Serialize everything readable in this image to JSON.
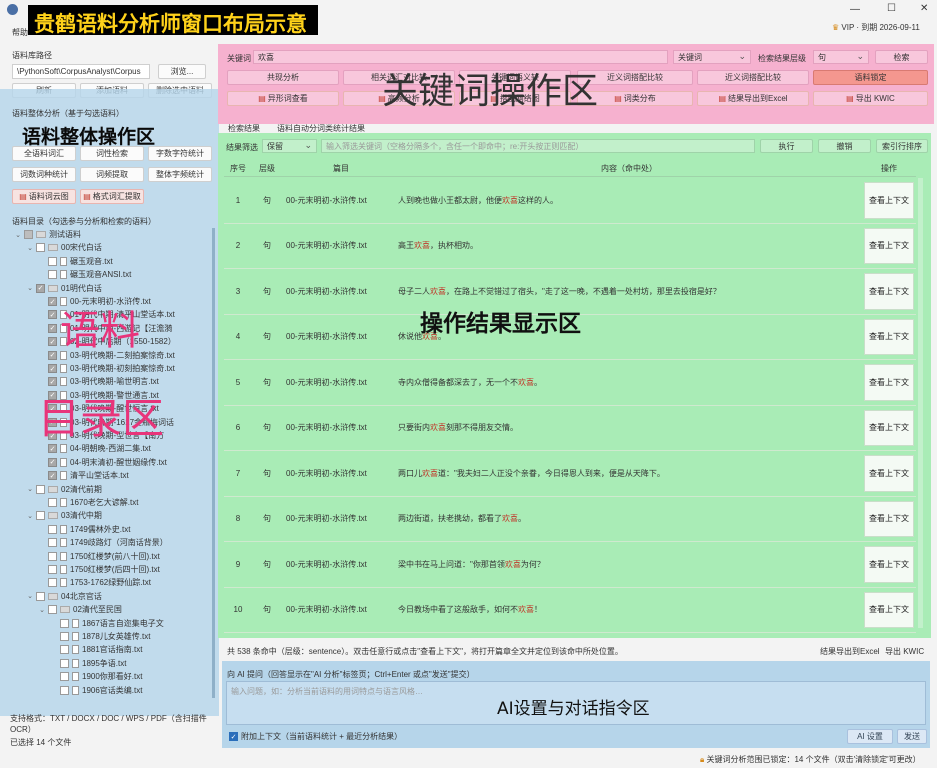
{
  "window": {
    "title": "贵鹤语料分析师窗口布局示意",
    "menu_help": "帮助",
    "vip": "VIP · 到期 2026-09-11",
    "min_icon": "—",
    "max_icon": "☐",
    "close_icon": "✕"
  },
  "overlays": {
    "keyword_area": "关键词操作区",
    "corpus_overall": "语料整体操作区",
    "corpus_dir_1": "语料",
    "corpus_dir_2": "目录区",
    "results_area": "操作结果显示区",
    "ai_area": "AI设置与对话指令区"
  },
  "corpus_path": {
    "label": "语料库路径",
    "value": "\\PythonSoft\\CorpusAnalyst\\Corpus",
    "browse": "浏览...",
    "refresh": "刷新",
    "add_corpus": "添加语料",
    "delete_selected": "删除选中语料"
  },
  "overall_ops": {
    "label": "语料整体分析（基于勾选语料）",
    "buttons": [
      "全语料词汇",
      "词性检索",
      "字数字符统计",
      "词数词种统计",
      "词频提取",
      "整体字频统计"
    ],
    "wordcloud": "语料词云图",
    "style_cmp": "格式词汇提取"
  },
  "corpus_tree": {
    "label": "语料目录（勾选参与分析和检索的语料）",
    "items": [
      {
        "level": 0,
        "type": "folder",
        "check": "part",
        "name": "测试语料"
      },
      {
        "level": 1,
        "type": "folder",
        "check": "off",
        "name": "00宋代白话"
      },
      {
        "level": 2,
        "type": "file",
        "check": "off",
        "name": "碾玉观音.txt"
      },
      {
        "level": 2,
        "type": "file",
        "check": "off",
        "name": "碾玉观音ANSI.txt"
      },
      {
        "level": 1,
        "type": "folder",
        "check": "on",
        "name": "01明代白话"
      },
      {
        "level": 2,
        "type": "file",
        "check": "on",
        "name": "00-元末明初-水浒传.txt"
      },
      {
        "level": 2,
        "type": "file",
        "check": "on",
        "name": "01-明代中期-清平山堂话本.txt"
      },
      {
        "level": 2,
        "type": "file",
        "check": "on",
        "name": "01-明代中期-西游记【汪澹漪"
      },
      {
        "level": 2,
        "type": "file",
        "check": "on",
        "name": "02-明代中后期（1550-1582）"
      },
      {
        "level": 2,
        "type": "file",
        "check": "on",
        "name": "03-明代晚期-二刻拍案惊奇.txt"
      },
      {
        "level": 2,
        "type": "file",
        "check": "on",
        "name": "03-明代晚期-初刻拍案惊奇.txt"
      },
      {
        "level": 2,
        "type": "file",
        "check": "on",
        "name": "03-明代晚期-喻世明言.txt"
      },
      {
        "level": 2,
        "type": "file",
        "check": "on",
        "name": "03-明代晚期-警世通言.txt"
      },
      {
        "level": 2,
        "type": "file",
        "check": "on",
        "name": "03-明代晚期-醒世恒言.txt"
      },
      {
        "level": 2,
        "type": "file",
        "check": "on",
        "name": "03-明代晚期-1617金瓶梅词话"
      },
      {
        "level": 2,
        "type": "file",
        "check": "on",
        "name": "03-明代晚期-型世言【南方"
      },
      {
        "level": 2,
        "type": "file",
        "check": "on",
        "name": "04-明朝晚-西湖二集.txt"
      },
      {
        "level": 2,
        "type": "file",
        "check": "on",
        "name": "04-明末清初-醒世姻缘传.txt"
      },
      {
        "level": 2,
        "type": "file",
        "check": "on",
        "name": "清平山堂话本.txt"
      },
      {
        "level": 1,
        "type": "folder",
        "check": "off",
        "name": "02清代前期"
      },
      {
        "level": 2,
        "type": "file",
        "check": "off",
        "name": "1670老乞大谚解.txt"
      },
      {
        "level": 1,
        "type": "folder",
        "check": "off",
        "name": "03清代中期"
      },
      {
        "level": 2,
        "type": "file",
        "check": "off",
        "name": "1749儒林外史.txt"
      },
      {
        "level": 2,
        "type": "file",
        "check": "off",
        "name": "1749歧路灯（河南话背景）"
      },
      {
        "level": 2,
        "type": "file",
        "check": "off",
        "name": "1750红楼梦(前八十回).txt"
      },
      {
        "level": 2,
        "type": "file",
        "check": "off",
        "name": "1750红楼梦(后四十回).txt"
      },
      {
        "level": 2,
        "type": "file",
        "check": "off",
        "name": "1753-1762绿野仙踪.txt"
      },
      {
        "level": 1,
        "type": "folder",
        "check": "off",
        "name": "04北京官话"
      },
      {
        "level": 2,
        "type": "folder",
        "check": "off",
        "name": "02清代至民国"
      },
      {
        "level": 3,
        "type": "file",
        "check": "off",
        "name": "1867语言自迩集电子文"
      },
      {
        "level": 3,
        "type": "file",
        "check": "off",
        "name": "1878儿女英雄传.txt"
      },
      {
        "level": 3,
        "type": "file",
        "check": "off",
        "name": "1881官话指南.txt"
      },
      {
        "level": 3,
        "type": "file",
        "check": "off",
        "name": "1895争语.txt"
      },
      {
        "level": 3,
        "type": "file",
        "check": "off",
        "name": "1900你那看好.txt"
      },
      {
        "level": 3,
        "type": "file",
        "check": "off",
        "name": "1906官话类编.txt"
      }
    ],
    "support": "支持格式：TXT / DOCX / DOC / WPS / PDF（含扫描件 OCR）",
    "selected": "已选择 14 个文件"
  },
  "keyword_ops": {
    "keyword_label": "关键词",
    "keyword_value": "欢喜",
    "mode_select": "关键词",
    "level_label": "检索结果层级",
    "level_value": "句",
    "search": "检索",
    "row1": [
      "共现分析",
      "相关词汇对比较",
      "关键词语义较",
      "近义词搭配比较",
      "近义词搭配比较",
      "语料锁定"
    ],
    "row2": [
      "异形词查看",
      "高频分析",
      "搭配网络图",
      "词类分布",
      "结果导出到Excel",
      "导出 KWIC"
    ]
  },
  "results": {
    "tabs": [
      "检索结果",
      "语料自动分词类统计结果"
    ],
    "filter_label": "结果筛选",
    "filter_mode": "保留",
    "filter_placeholder": "输入筛选关键词（空格分隔多个，含任一个即命中；re:开头按正则匹配）",
    "execute": "执行",
    "undo": "撤销",
    "sort": "索引行排序",
    "headers": {
      "no": "序号",
      "level": "层级",
      "title": "篇目",
      "content": "内容（命中处）",
      "op": "操作"
    },
    "op_label": "查看上下文",
    "rows": [
      {
        "no": "1",
        "level": "句",
        "title": "00-元末明初-水浒传.txt",
        "pre": "人到晚也做小王都太尉，他便",
        "kw": "欢喜",
        "post": "这样的人。"
      },
      {
        "no": "2",
        "level": "句",
        "title": "00-元末明初-水浒传.txt",
        "pre": "高王",
        "kw": "欢喜",
        "post": "，执杯相劝。"
      },
      {
        "no": "3",
        "level": "句",
        "title": "00-元末明初-水浒传.txt",
        "pre": "母子二人",
        "kw": "欢喜",
        "post": "，在路上不觉错过了宿头，\"走了这一晚，不遇着一处村坊，那里去投宿是好？"
      },
      {
        "no": "4",
        "level": "句",
        "title": "00-元末明初-水浒传.txt",
        "pre": "休说他",
        "kw": "欢喜",
        "post": "。"
      },
      {
        "no": "5",
        "level": "句",
        "title": "00-元末明初-水浒传.txt",
        "pre": "寺内众僧得备都深去了，无一个不",
        "kw": "欢喜",
        "post": "。"
      },
      {
        "no": "6",
        "level": "句",
        "title": "00-元末明初-水浒传.txt",
        "pre": "只要街内",
        "kw": "欢喜",
        "post": "刻那不得朋友交情。"
      },
      {
        "no": "7",
        "level": "句",
        "title": "00-元末明初-水浒传.txt",
        "pre": "两口儿",
        "kw": "欢喜",
        "post": "道：\"我夫妇二人正没个亲眷，今日得恩人到来，便是从天降下。"
      },
      {
        "no": "8",
        "level": "句",
        "title": "00-元末明初-水浒传.txt",
        "pre": "两边街道，扶老携幼，都看了",
        "kw": "欢喜",
        "post": "。"
      },
      {
        "no": "9",
        "level": "句",
        "title": "00-元末明初-水浒传.txt",
        "pre": "梁中书在马上问道：\"你那首领",
        "kw": "欢喜",
        "post": "为何？"
      },
      {
        "no": "10",
        "level": "句",
        "title": "00-元末明初-水浒传.txt",
        "pre": "今日教场中看了这般敌手，如何不",
        "kw": "欢喜",
        "post": "！"
      }
    ],
    "status": "共 538 条命中（层级：sentence）。双击任意行或点击\"查看上下文\"，将打开篇章全文并定位到该命中所处位置。",
    "export_excel": "结果导出到Excel",
    "export_kwic": "导出 KWIC"
  },
  "ai": {
    "title": "向 AI 提问（回答显示在\"AI 分析\"标签页；Ctrl+Enter 或点\"发送\"提交）",
    "placeholder": "输入问题，如：分析当前语料的用词特点与语言风格…",
    "attach": "附加上下文（当前语料统计 + 最近分析结果）",
    "settings": "AI 设置",
    "send": "发送"
  },
  "statusbar": {
    "lock": "关键词分析范围已锁定：14 个文件（双击'清除锁定'可更改）"
  },
  "colors": {
    "pink": "#f6b1cf",
    "green": "#a9ecb6",
    "blue": "#b6d5ea",
    "hl": "#c0392b"
  }
}
